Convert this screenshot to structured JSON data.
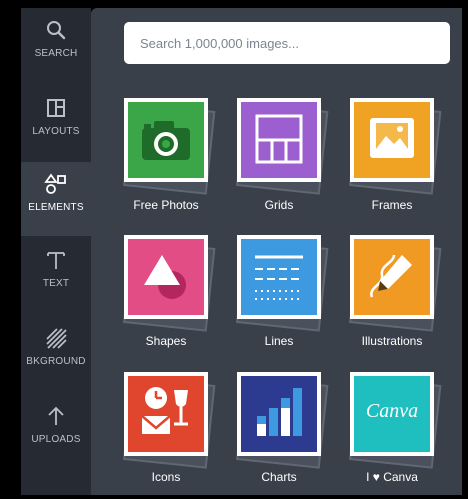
{
  "rail": {
    "items": [
      {
        "label": "SEARCH",
        "icon": "search-icon"
      },
      {
        "label": "LAYOUTS",
        "icon": "layouts-icon"
      },
      {
        "label": "ELEMENTS",
        "icon": "elements-icon"
      },
      {
        "label": "TEXT",
        "icon": "text-icon"
      },
      {
        "label": "BKGROUND",
        "icon": "background-icon"
      },
      {
        "label": "UPLOADS",
        "icon": "uploads-icon"
      }
    ]
  },
  "search": {
    "placeholder": "Search 1,000,000 images..."
  },
  "tiles": [
    {
      "label": "Free Photos",
      "color": "#3aa648"
    },
    {
      "label": "Grids",
      "color": "#9c5fd0"
    },
    {
      "label": "Frames",
      "color": "#f0a322"
    },
    {
      "label": "Shapes",
      "color": "#e24d86"
    },
    {
      "label": "Lines",
      "color": "#3d9ae0"
    },
    {
      "label": "Illustrations",
      "color": "#f09a23"
    },
    {
      "label": "Icons",
      "color": "#e0452d"
    },
    {
      "label": "Charts",
      "color": "#2c3a8f"
    },
    {
      "label": "I ♥ Canva",
      "color": "#1fbfbf"
    }
  ],
  "canva_logo_text": "Canva"
}
